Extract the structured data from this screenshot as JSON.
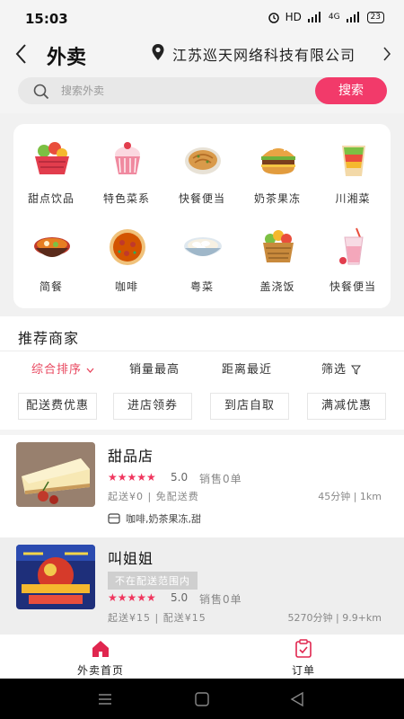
{
  "status_bar": {
    "time": "15:03",
    "network": "HD",
    "signal": "4G",
    "battery": "23"
  },
  "header": {
    "title": "外卖",
    "location": "江苏巡天网络科技有限公司"
  },
  "search": {
    "placeholder": "搜索外卖",
    "button_label": "搜索"
  },
  "categories": [
    {
      "label": "甜点饮品",
      "icon": "fruit-basket-icon"
    },
    {
      "label": "特色菜系",
      "icon": "cake-icon"
    },
    {
      "label": "快餐便当",
      "icon": "pancake-icon"
    },
    {
      "label": "奶茶果冻",
      "icon": "burger-icon"
    },
    {
      "label": "川湘菜",
      "icon": "wrap-icon"
    },
    {
      "label": "简餐",
      "icon": "hotpot-icon"
    },
    {
      "label": "咖啡",
      "icon": "pizza-icon"
    },
    {
      "label": "粤菜",
      "icon": "dumpling-bowl-icon"
    },
    {
      "label": "盖浇饭",
      "icon": "grocery-basket-icon"
    },
    {
      "label": "快餐便当",
      "icon": "milkshake-icon"
    }
  ],
  "section_title": "推荐商家",
  "sort_tabs": [
    {
      "label": "综合排序",
      "active": true
    },
    {
      "label": "销量最高",
      "active": false
    },
    {
      "label": "距离最近",
      "active": false
    },
    {
      "label": "筛选",
      "active": false
    }
  ],
  "filter_chips": [
    "配送费优惠",
    "进店领券",
    "到店自取",
    "满减优惠"
  ],
  "merchants": [
    {
      "name": "甜品店",
      "rating": "5.0",
      "sales": "销售0单",
      "delivery": "起送¥0 | 免配送费",
      "eta": "45分钟 | 1km",
      "tags": "咖啡,奶茶果冻,甜",
      "status": ""
    },
    {
      "name": "叫姐姐",
      "rating": "5.0",
      "sales": "销售0单",
      "delivery": "起送¥15 | 配送¥15",
      "eta": "5270分钟 | 9.9+km",
      "tags": "",
      "status": "不在配送范围内"
    }
  ],
  "bottom_nav": [
    {
      "label": "外卖首页",
      "icon": "home-icon",
      "active": true
    },
    {
      "label": "订单",
      "icon": "order-icon",
      "active": false
    }
  ],
  "colors": {
    "accent": "#f23a6a",
    "active_tab": "#e8465e",
    "star": "#f0365e"
  }
}
